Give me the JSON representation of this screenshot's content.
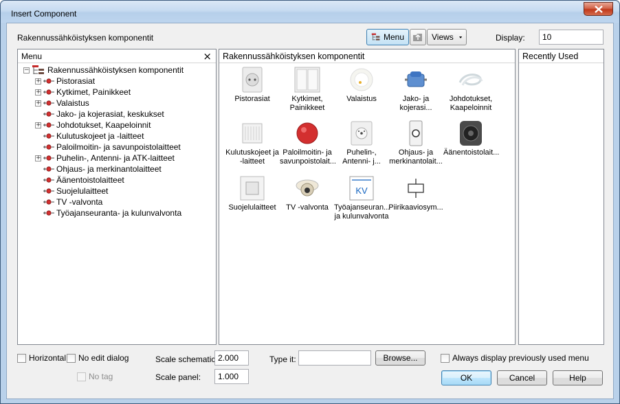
{
  "window": {
    "title": "Insert Component"
  },
  "header": {
    "path_label": "Rakennussähköistyksen komponentit",
    "menu_button": "Menu",
    "views_button": "Views",
    "display_label": "Display:",
    "display_value": "10"
  },
  "menu_panel": {
    "title": "Menu",
    "close_glyph": "×",
    "root": "Rakennussähköistyksen komponentit",
    "items": [
      {
        "label": "Pistorasiat",
        "expandable": true
      },
      {
        "label": "Kytkimet, Painikkeet",
        "expandable": true
      },
      {
        "label": "Valaistus",
        "expandable": true
      },
      {
        "label": "Jako- ja kojerasiat, keskukset",
        "expandable": false
      },
      {
        "label": "Johdotukset, Kaapeloinnit",
        "expandable": true
      },
      {
        "label": "Kulutuskojeet ja -laitteet",
        "expandable": false
      },
      {
        "label": "Paloilmoitin- ja savunpoistolaitteet",
        "expandable": false
      },
      {
        "label": "Puhelin-, Antenni- ja ATK-laitteet",
        "expandable": true
      },
      {
        "label": "Ohjaus- ja merkinantolaitteet",
        "expandable": false
      },
      {
        "label": "Äänentoistolaitteet",
        "expandable": false
      },
      {
        "label": "Suojelulaitteet",
        "expandable": false
      },
      {
        "label": "TV -valvonta",
        "expandable": false
      },
      {
        "label": "Työajanseuranta- ja kulunvalvonta",
        "expandable": false
      }
    ]
  },
  "components_panel": {
    "title": "Rakennussähköistyksen komponentit",
    "items": [
      {
        "line1": "Pistorasiat",
        "line2": "",
        "icon": "socket-icon"
      },
      {
        "line1": "Kytkimet,",
        "line2": "Painikkeet",
        "icon": "switch-icon"
      },
      {
        "line1": "Valaistus",
        "line2": "",
        "icon": "lamp-icon"
      },
      {
        "line1": "Jako- ja",
        "line2": "kojerasi...",
        "icon": "junction-box-icon"
      },
      {
        "line1": "Johdotukset,",
        "line2": "Kaapeloinnit",
        "icon": "cable-icon"
      },
      {
        "line1": "Kulutuskojeet ja",
        "line2": "-laitteet",
        "icon": "radiator-icon"
      },
      {
        "line1": "Paloilmoitin- ja",
        "line2": "savunpoistolait...",
        "icon": "fire-alarm-icon"
      },
      {
        "line1": "Puhelin-,",
        "line2": "Antenni- j...",
        "icon": "antenna-socket-icon"
      },
      {
        "line1": "Ohjaus- ja",
        "line2": "merkinantolait...",
        "icon": "doorbell-icon"
      },
      {
        "line1": "Äänentoistolait...",
        "line2": "",
        "icon": "speaker-icon"
      },
      {
        "line1": "Suojelulaitteet",
        "line2": "",
        "icon": "protection-device-icon"
      },
      {
        "line1": "TV -valvonta",
        "line2": "",
        "icon": "cctv-camera-icon"
      },
      {
        "line1": "Työajanseuran...",
        "line2": "ja kulunvalvonta",
        "icon": "kv-symbol-icon",
        "badge": "KV"
      },
      {
        "line1": "Piirikaaviosym...",
        "line2": "",
        "icon": "schematic-symbol-icon"
      }
    ]
  },
  "recent_panel": {
    "title": "Recently Used"
  },
  "footer": {
    "horizontal": "Horizontal",
    "no_edit_dialog": "No edit dialog",
    "no_tag": "No tag",
    "scale_schematic_label": "Scale schematic:",
    "scale_schematic_value": "2.000",
    "scale_panel_label": "Scale panel:",
    "scale_panel_value": "1.000",
    "type_it_label": "Type it:",
    "type_it_value": "",
    "browse_button": "Browse...",
    "always_display": "Always display previously used menu",
    "ok_button": "OK",
    "cancel_button": "Cancel",
    "help_button": "Help"
  },
  "colors": {
    "accent": "#3c7fb1",
    "close": "#c0391b",
    "frame": "#b9d1ea"
  }
}
